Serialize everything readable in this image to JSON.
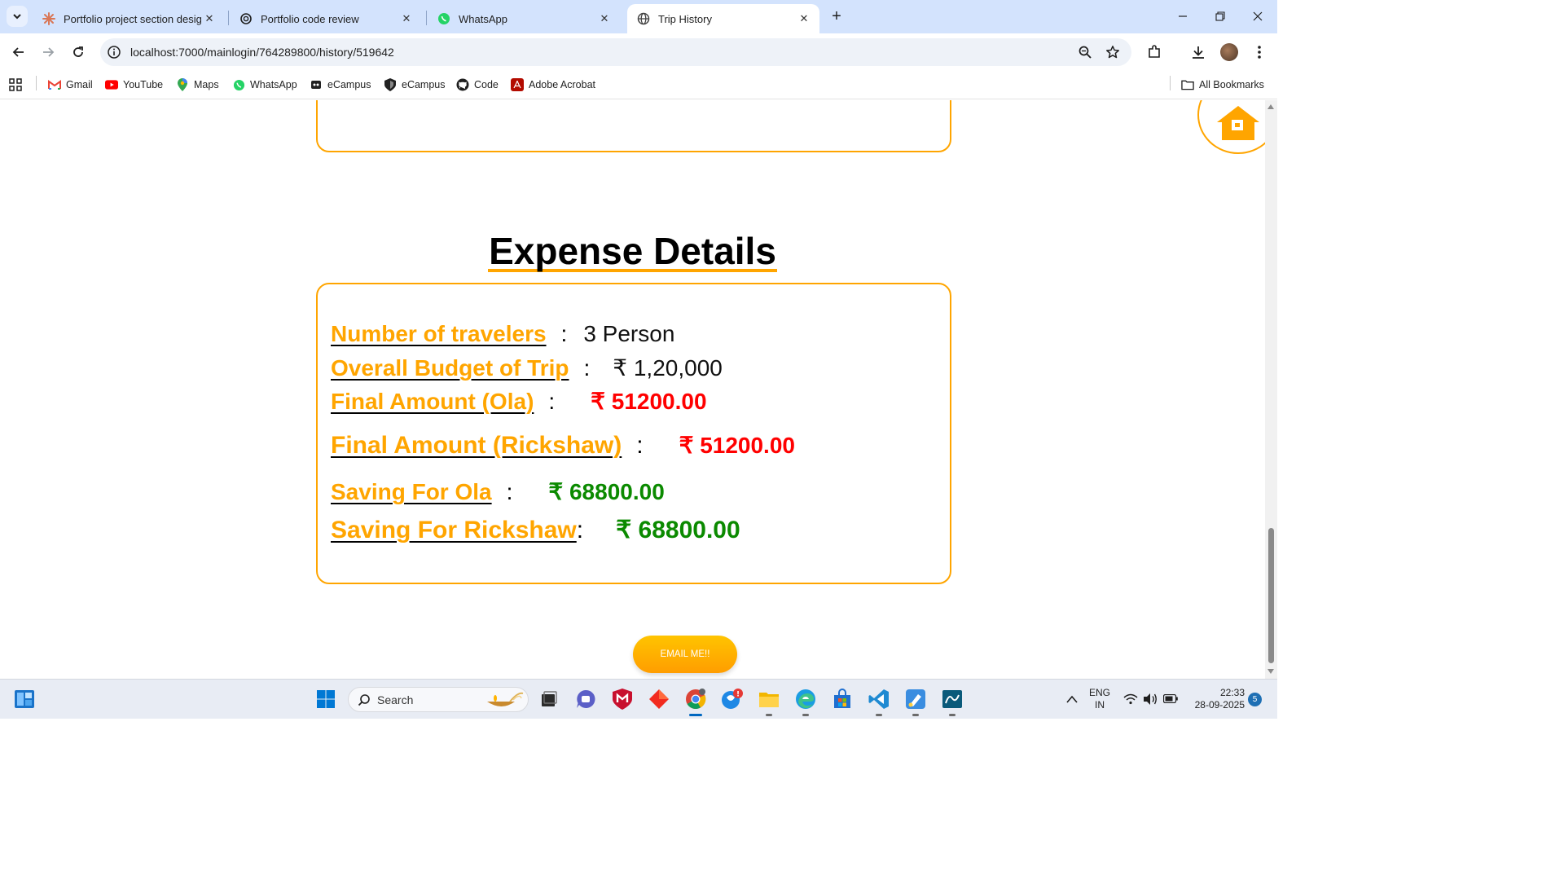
{
  "browser": {
    "tabs": [
      {
        "title": "Portfolio project section design",
        "active": false
      },
      {
        "title": "Portfolio code review",
        "active": false
      },
      {
        "title": "WhatsApp",
        "active": false
      },
      {
        "title": "Trip History",
        "active": true
      }
    ],
    "url": "localhost:7000/mainlogin/764289800/history/519642",
    "bookmarks": [
      "Gmail",
      "YouTube",
      "Maps",
      "WhatsApp",
      "eCampus",
      "eCampus",
      "Code",
      "Adobe Acrobat"
    ],
    "all_bookmarks_label": "All Bookmarks"
  },
  "page": {
    "section_title": "Expense Details",
    "rows": {
      "travelers": {
        "label": "Number of travelers ",
        "value": "3 Person"
      },
      "budget": {
        "label": "Overall Budget of Trip ",
        "value": "₹ 1,20,000"
      },
      "final_ola": {
        "label": "Final Amount (Ola) ",
        "value": "₹ 51200.00"
      },
      "final_rickshaw": {
        "label": "Final Amount (Rickshaw) ",
        "value": "₹ 51200.00"
      },
      "saving_ola": {
        "label": "Saving For Ola ",
        "value": "₹ 68800.00"
      },
      "saving_rickshaw": {
        "label": "Saving For Rickshaw",
        "value": "₹ 68800.00"
      }
    },
    "colon": ":",
    "email_button": "EMAIL ME!!"
  },
  "taskbar": {
    "search_placeholder": "Search",
    "language": "ENG",
    "region": "IN",
    "time": "22:33",
    "date": "28-09-2025",
    "notification_count": "5"
  },
  "colors": {
    "accent_orange": "#ffa500",
    "amount_red": "#ff0000",
    "saving_green": "#0b8a00",
    "tab_strip": "#d3e3fd"
  }
}
